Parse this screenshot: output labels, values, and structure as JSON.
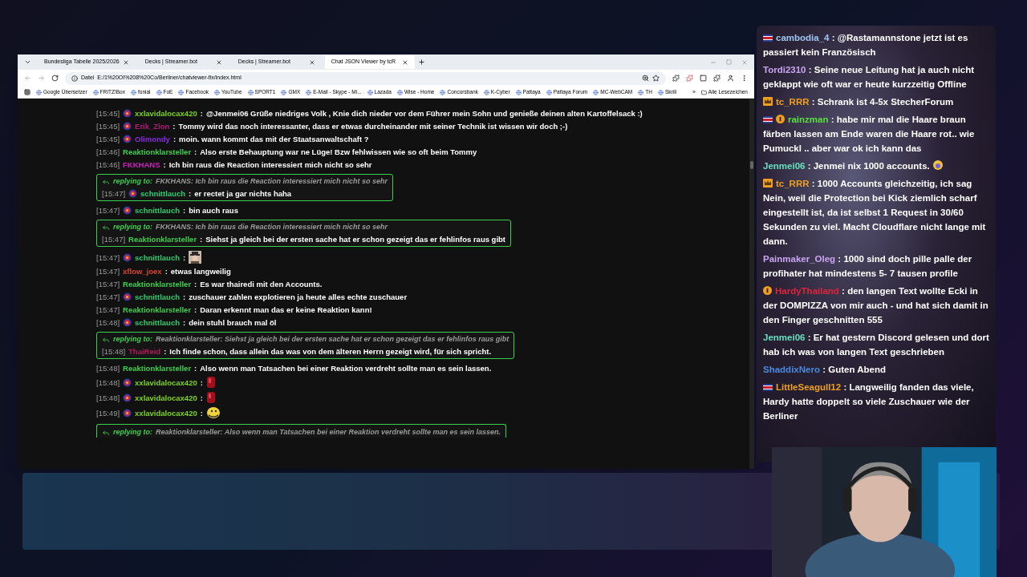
{
  "browser": {
    "tabs": [
      {
        "title": "Bundesliga Tabelle 2025/2026",
        "selected": false
      },
      {
        "title": "Decks | Streamer.bot",
        "selected": false
      },
      {
        "title": "Decks | Streamer.bot",
        "selected": false
      },
      {
        "title": "Chat JSON Viewer by tcR",
        "selected": true
      }
    ],
    "address_label": "Datei",
    "address": "E:/1%20OI%208%20Co/Berliner/chatviewer-fix/index.html",
    "bookmarks": [
      "Google Übersetzer",
      "FRITZ!Box",
      "fonial",
      "FoE",
      "Facebook",
      "YouTube",
      "SPORT1",
      "GMX",
      "E-Mail - Skype - Mi...",
      "Lazada",
      "Wise - Home",
      "Concorsbank",
      "K-Cyber",
      "Pattaya",
      "Pattaya Forum",
      "MC-WebCAM",
      "TH",
      "Skrill"
    ],
    "more": "»",
    "all_bookmarks": "Alle Lesezeichen"
  },
  "separator": ":",
  "chat": [
    {
      "kind": "message",
      "time": "[15:45]",
      "user": "xxlavidalocax420",
      "color": "#7ed321",
      "badge": true,
      "text": "@Jenmei06 Grüße niedriges Volk , Knie dich nieder vor dem Führer mein Sohn und genieße deinen alten Kartoffelsack :)"
    },
    {
      "kind": "message",
      "time": "[15:45]",
      "user": "Erik_Zion",
      "color": "#b5177a",
      "badge": true,
      "text": "Tommy wird das noch interessanter, dass er etwas durcheinander mit seiner Technik ist wissen wir doch ;-)"
    },
    {
      "kind": "message",
      "time": "[15:45]",
      "user": "Olimondy",
      "color": "#8a2be2",
      "badge": true,
      "text": "moin. wann kommt das mit der Staatsanwaltschaft ?"
    },
    {
      "kind": "message",
      "time": "[15:46]",
      "user": "Reaktionklarsteller",
      "color": "#3ccf4e",
      "badge": false,
      "text": "Also erste Behauptung war ne Lüge! Bzw fehlwissen wie so oft beim Tommy"
    },
    {
      "kind": "message",
      "time": "[15:46]",
      "user": "FKKHANS",
      "color": "#d01fbf",
      "badge": false,
      "text": "Ich bin raus die Reaction interessiert mich nicht so sehr"
    },
    {
      "kind": "reply",
      "reply_label": "replying to:",
      "reply_to": "FKKHANS: Ich bin raus die Reaction interessiert mich nicht so sehr",
      "time": "[15:47]",
      "user": "schnittlauch",
      "color": "#2ecc71",
      "badge": true,
      "text": "er rectet ja gar nichts haha"
    },
    {
      "kind": "message",
      "time": "[15:47]",
      "user": "schnittlauch",
      "color": "#2ecc71",
      "badge": true,
      "text": "bin auch raus"
    },
    {
      "kind": "reply",
      "reply_label": "replying to:",
      "reply_to": "FKKHANS: Ich bin raus die Reaction interessiert mich nicht so sehr",
      "time": "[15:47]",
      "user": "Reaktionklarsteller",
      "color": "#3ccf4e",
      "badge": false,
      "text": "Siehst ja gleich bei der ersten sache hat er schon gezeigt das er fehlinfos raus gibt"
    },
    {
      "kind": "message",
      "time": "[15:47]",
      "user": "schnittlauch",
      "color": "#2ecc71",
      "badge": true
    },
    {
      "kind": "message",
      "time": "[15:47]",
      "user": "xflow_joex",
      "color": "#d9462f",
      "badge": false,
      "text": "etwas langweilig"
    },
    {
      "kind": "message",
      "time": "[15:47]",
      "user": "Reaktionklarsteller",
      "color": "#3ccf4e",
      "badge": false,
      "text": "Es war thairedi mit den Accounts."
    },
    {
      "kind": "message",
      "time": "[15:47]",
      "user": "schnittlauch",
      "color": "#2ecc71",
      "badge": true,
      "text": "zuschauer zahlen explotieren ja heute alles echte zuschauer"
    },
    {
      "kind": "message",
      "time": "[15:47]",
      "user": "Reaktionklarsteller",
      "color": "#3ccf4e",
      "badge": false,
      "text": "Daran erkennt man das er keine Reaktion kann!"
    },
    {
      "kind": "message",
      "time": "[15:48]",
      "user": "schnittlauch",
      "color": "#2ecc71",
      "badge": true,
      "text": "dein stuhl brauch mal öl"
    },
    {
      "kind": "reply",
      "reply_label": "replying to:",
      "reply_to": "Reaktionklarsteller: Siehst ja gleich bei der ersten sache hat er schon gezeigt das er fehlinfos raus gibt",
      "time": "[15:48]",
      "user": "ThaiReid",
      "color": "#b0185c",
      "badge": false,
      "text": "Ich finde schon, dass allein das was von dem älteren Herrn gezeigt wird, für sich spricht."
    },
    {
      "kind": "message",
      "time": "[15:48]",
      "user": "Reaktionklarsteller",
      "color": "#3ccf4e",
      "badge": false,
      "text": "Also wenn man Tatsachen bei einer Reaktion verdreht sollte man es sein lassen."
    },
    {
      "kind": "message",
      "time": "[15:48]",
      "user": "xxlavidalocax420",
      "color": "#7ed321",
      "badge": true,
      "emote": {
        "kind": "red"
      }
    },
    {
      "kind": "message",
      "time": "[15:48]",
      "user": "xxlavidalocax420",
      "color": "#7ed321",
      "badge": true,
      "emote": {
        "kind": "red"
      }
    },
    {
      "kind": "message",
      "time": "[15:49]",
      "user": "xxlavidalocax420",
      "color": "#7ed321",
      "badge": true,
      "emote": {
        "kind": "smiley"
      }
    },
    {
      "kind": "reply_cut",
      "reply_label": "replying to:",
      "reply_to": "Reaktionklarsteller: Also wenn man Tatsachen bei einer Reaktion verdreht sollte man es sein lassen."
    }
  ],
  "overlay": [
    {
      "user": "cambodia_4",
      "color": "#9ec5f0",
      "badges": [
        {
          "kind": "flag"
        }
      ],
      "text": "@Rastamannstone jetzt ist es passiert kein Französisch"
    },
    {
      "user": "Tordi2310",
      "color": "#c9a4f2",
      "text": "Seine neue Leitung hat ja auch nicht geklappt wie oft war er heute kurzzeitig Offline"
    },
    {
      "user": "tc_RRR",
      "color": "#f0a020",
      "badges": [
        {
          "kind": "crown"
        }
      ],
      "text": "Schrank ist 4-5x StecherForum"
    },
    {
      "user": "rainzman",
      "color": "#58e040",
      "badges": [
        {
          "kind": "flag"
        },
        {
          "kind": "one"
        }
      ],
      "text": "habe mir mal die Haare braun färben lassen am Ende waren die Haare rot.. wie Pumuckl .. aber war ok ich kann das"
    },
    {
      "user": "Jenmei06",
      "color": "#66e0c0",
      "text": "Jenmei nix 1000 accounts.",
      "emote": true
    },
    {
      "user": "tc_RRR",
      "color": "#f0a020",
      "badges": [
        {
          "kind": "crown"
        }
      ],
      "text": "1000 Accounts gleichzeitig, ich sag Nein, weil die Protection bei Kick ziemlich scharf eingestellt ist, da ist selbst 1 Request in 30/60 Sekunden zu viel. Macht Cloudflare nicht lange mit dann."
    },
    {
      "user": "Painmaker_Oleg",
      "color": "#c9a4f2",
      "text": "1000 sind doch pille palle der profihater hat mindestens 5- 7 tausen profile"
    },
    {
      "user": "HardyThailand",
      "color": "#e0243a",
      "badges": [
        {
          "kind": "one"
        }
      ],
      "text": "den langen Text wollte Ecki in der DOMPIZZA von mir auch - und hat sich damit in den Finger geschnitten 555"
    },
    {
      "user": "Jenmei06",
      "color": "#66e0c0",
      "text": "Er hat gestern Discord gelesen und dort hab ich was von langen Text geschrieben"
    },
    {
      "user": "ShaddixNero",
      "color": "#4a8ae0",
      "text": "Guten Abend"
    },
    {
      "user": "LittleSeagull12",
      "color": "#f0a020",
      "badges": [
        {
          "kind": "flag"
        }
      ],
      "text": "Langweilig fanden das viele, Hardy hatte doppelt so viele Zuschauer wie der Berliner"
    }
  ]
}
